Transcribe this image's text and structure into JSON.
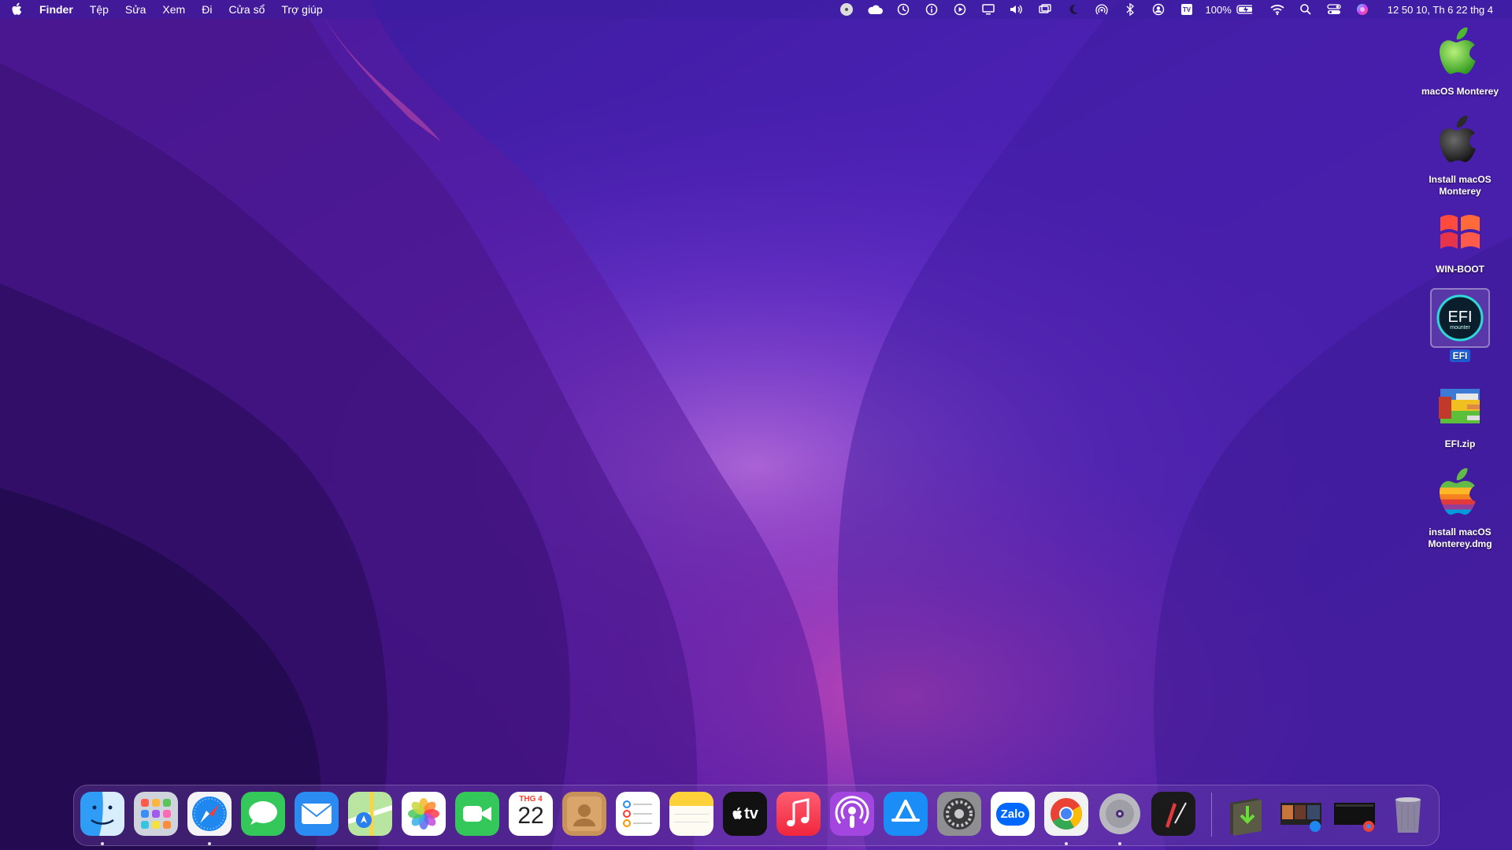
{
  "menubar": {
    "app_name": "Finder",
    "menus": [
      "Tệp",
      "Sửa",
      "Xem",
      "Đi",
      "Cửa sổ",
      "Trợ giúp"
    ],
    "status_icons": [
      "disk-icon",
      "cloud-icon",
      "time-machine-icon",
      "info-icon",
      "play-icon",
      "display-icon",
      "volume-icon",
      "screens-icon",
      "moon-icon",
      "airdrop-icon",
      "bluetooth-icon",
      "user-icon",
      "input-method-icon"
    ],
    "battery_percent": "100%",
    "right_icons": [
      "wifi-icon",
      "spotlight-icon",
      "control-center-icon",
      "siri-icon"
    ],
    "clock": "12 50 10, Th 6 22 thg 4"
  },
  "desktop": {
    "items": [
      {
        "label": "macOS Monterey",
        "icon": "green-apple-disk-icon"
      },
      {
        "label": "Install macOS Monterey",
        "icon": "dark-apple-disk-icon"
      },
      {
        "label": "WIN-BOOT",
        "icon": "windows-disk-icon"
      },
      {
        "label": "EFI",
        "icon": "efi-mounter-icon",
        "selected": true
      },
      {
        "label": "EFI.zip",
        "icon": "archive-icon"
      },
      {
        "label": "install macOS Monterey.dmg",
        "icon": "rainbow-apple-icon"
      }
    ]
  },
  "dock": {
    "calendar_month": "THG 4",
    "calendar_day": "22",
    "zalo_label": "Zalo",
    "tv_label": "tv",
    "apps": [
      "finder",
      "launchpad",
      "safari",
      "messages",
      "mail",
      "maps",
      "photos",
      "facetime",
      "calendar",
      "contacts",
      "reminders",
      "notes",
      "apple-tv",
      "music",
      "podcasts",
      "app-store",
      "system-preferences",
      "zalo",
      "chrome",
      "disk-utility",
      "pdf-app",
      "downloads",
      "safari-window",
      "chrome-window",
      "trash"
    ]
  },
  "colors": {
    "accent": "#1f5fd6",
    "menubar_bg": "#3c1ea0"
  }
}
